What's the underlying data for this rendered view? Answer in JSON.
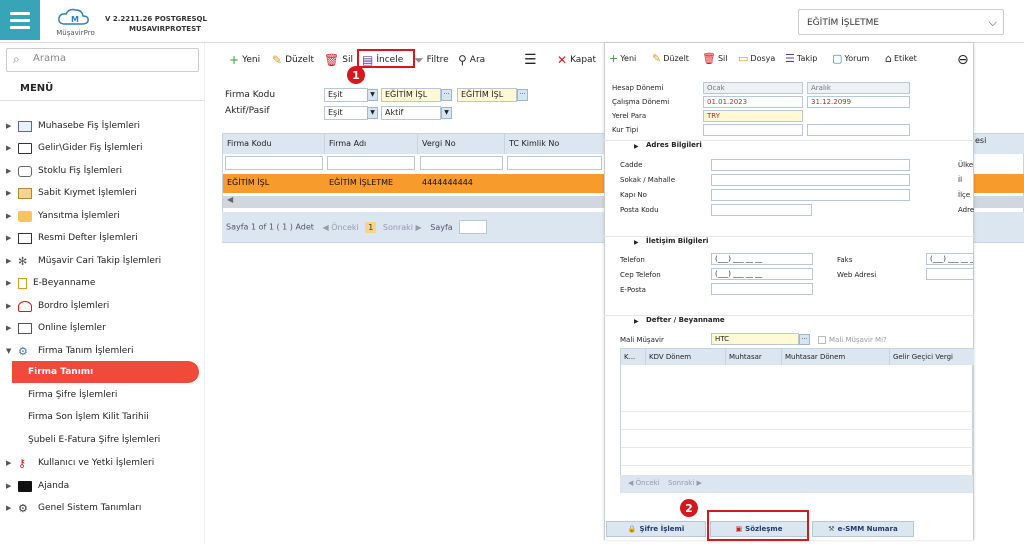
{
  "header": {
    "logo_text": "MüşavirPro",
    "version": "V 2.2211.26 POSTGRESQL",
    "db": "MUSAVIRPROTEST",
    "company": "EĞİTİM İŞLETME"
  },
  "sidebar": {
    "search_placeholder": "Arama",
    "menu_title": "MENÜ",
    "items": [
      {
        "label": "Muhasebe Fiş İşlemleri"
      },
      {
        "label": "Gelir\\Gider Fiş İşlemleri"
      },
      {
        "label": "Stoklu Fiş İşlemleri"
      },
      {
        "label": "Sabit Kıymet İşlemleri"
      },
      {
        "label": "Yansıtma İşlemleri"
      },
      {
        "label": "Resmi Defter İşlemleri"
      },
      {
        "label": "Müşavir Cari Takip İşlemleri"
      },
      {
        "label": "E-Beyanname"
      },
      {
        "label": "Bordro İşlemleri"
      },
      {
        "label": "Online İşlemler"
      },
      {
        "label": "Firma Tanım İşlemleri"
      },
      {
        "label": "Kullanıcı ve Yetki İşlemleri"
      },
      {
        "label": "Ajanda"
      },
      {
        "label": "Genel Sistem Tanımları"
      }
    ],
    "subitems": [
      {
        "label": "Firma Tanımı"
      },
      {
        "label": "Firma Şifre İşlemleri"
      },
      {
        "label": "Firma Son İşlem Kilit Tarihii"
      },
      {
        "label": "Şubeli E-Fatura Şifre İşlemleri"
      }
    ]
  },
  "toolbar": {
    "new": "Yeni",
    "edit": "Düzelt",
    "delete": "Sil",
    "inspect": "İncele",
    "filter": "Filtre",
    "search": "Ara",
    "close": "Kapat",
    "badge1": "1",
    "badge2": "2"
  },
  "filters": {
    "firma_kodu_label": "Firma Kodu",
    "aktif_label": "Aktif/Pasif",
    "op1": "Eşit",
    "val1": "EĞİTİM İŞL",
    "val1b": "EĞİTİM İŞL",
    "op2": "Eşit",
    "val2": "Aktif"
  },
  "grid": {
    "columns": [
      "Firma Kodu",
      "Firma Adı",
      "Vergi No",
      "TC Kimlik No",
      "esi"
    ],
    "row": {
      "kod": "EĞİTİM İŞL",
      "ad": "EĞİTİM İŞLETME",
      "vergi": "4444444444"
    },
    "pager": {
      "text": "Sayfa 1 of 1 ( 1 ) Adet",
      "prev": "Önceki",
      "page": "1",
      "next": "Sonraki",
      "sayfa": "Sayfa"
    }
  },
  "panel": {
    "toolbar": {
      "new": "Yeni",
      "edit": "Düzelt",
      "delete": "Sil",
      "file": "Dosya",
      "track": "Takip",
      "comment": "Yorum",
      "tag": "Etiket"
    },
    "labels": {
      "hesap_donemi": "Hesap Dönemi",
      "calisma_donemi": "Çalışma Dönemi",
      "yerel_para": "Yerel Para",
      "kur_tipi": "Kur Tipi",
      "adres": "Adres Bilgileri",
      "cadde": "Cadde",
      "sokak": "Sokak / Mahalle",
      "kapi": "Kapı No",
      "posta": "Posta Kodu",
      "ulke": "Ülke",
      "il": "İl",
      "ilce": "İlçe",
      "adres_r": "Adre",
      "iletisim": "İletişim Bilgileri",
      "telefon": "Telefon",
      "cep": "Cep Telefon",
      "eposta": "E-Posta",
      "faks": "Faks",
      "web": "Web Adresi",
      "defter": "Defter / Beyanname",
      "mali_musavir": "Mali Müşavir",
      "mali_musavir_mi": "Mali Müşavir Mi?"
    },
    "values": {
      "ocak": "Ocak",
      "aralik": "Aralık",
      "start_date": "01.01.2023",
      "end_date": "31.12.2099",
      "currency": "TRY",
      "phone_mask": "(___) ___ __ __",
      "musavir": "HTC"
    },
    "table_columns": [
      "K...",
      "KDV Dönem",
      "Muhtasar",
      "Muhtasar Dönem",
      "Gelir Geçici Vergi"
    ],
    "table_pager": {
      "prev": "Önceki",
      "next": "Sonraki"
    },
    "tabs": [
      "Şifre İşlemi",
      "Sözleşme",
      "e-SMM Numara"
    ]
  }
}
